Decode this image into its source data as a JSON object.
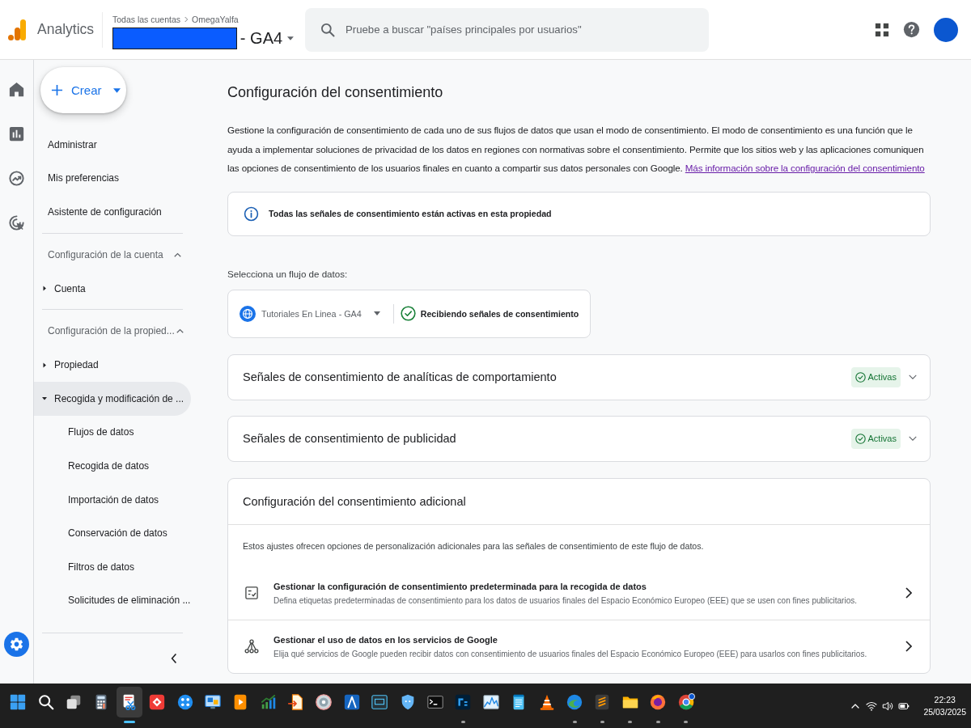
{
  "header": {
    "product": "Analytics",
    "breadcrumb": [
      "Todas las cuentas",
      "OmegaYalfa"
    ],
    "property_suffix": "- GA4",
    "search": {
      "placeholder": "Pruebe a buscar \"países principales por usuarios\""
    }
  },
  "rail": [
    {
      "selected": false
    },
    {
      "selected": false
    },
    {
      "selected": false
    },
    {
      "selected": false
    },
    {
      "selected": true
    }
  ],
  "sidebar": {
    "create_button": {
      "label": "Crear"
    },
    "links": [
      {
        "label": "Administrar",
        "selected": false
      },
      {
        "label": "Mis preferencias",
        "selected": false
      },
      {
        "label": "Asistente de configuración",
        "selected": false
      }
    ],
    "sections": [
      {
        "title": "Configuración de la cuenta",
        "expanded": true,
        "items": [
          {
            "label": "Cuenta",
            "expanded": false,
            "selected": false
          }
        ]
      },
      {
        "title": "Configuración de la propied...",
        "expanded": true,
        "items": [
          {
            "label": "Propiedad",
            "expanded": false,
            "selected": false
          },
          {
            "label": "Recogida y modificación de ...",
            "expanded": true,
            "selected": true,
            "children": [
              {
                "label": "Flujos de datos",
                "selected": false
              },
              {
                "label": "Recogida de datos",
                "selected": false
              },
              {
                "label": "Importación de datos",
                "selected": false
              },
              {
                "label": "Conservación de datos",
                "selected": false
              },
              {
                "label": "Filtros de datos",
                "selected": false
              },
              {
                "label": "Solicitudes de eliminación ...",
                "selected": false
              }
            ]
          }
        ]
      }
    ]
  },
  "page": {
    "title": "Configuración del consentimiento",
    "intro": "Gestione la configuración de consentimiento de cada uno de sus flujos de datos que usan el modo de consentimiento. El modo de consentimiento es una función que le ayuda a implementar soluciones de privacidad de los datos en regiones con normativas sobre el consentimiento. Permite que los sitios web y las aplicaciones comuniquen las opciones de consentimiento de los usuarios finales en cuanto a compartir sus datos personales con Google.",
    "intro_link": "Más información sobre la configuración del consentimiento",
    "notice": "Todas las señales de consentimiento están activas en esta propiedad",
    "stream_label": "Selecciona un flujo de datos:",
    "stream": {
      "name": "Tutoriales En Linea - GA4",
      "status": "Recibiendo señales de consentimiento"
    },
    "signal_panels": [
      {
        "title": "Señales de consentimiento de analíticas de comportamiento",
        "badge": "Activas",
        "expanded": false
      },
      {
        "title": "Señales de consentimiento de publicidad",
        "badge": "Activas",
        "expanded": false
      }
    ],
    "additional": {
      "title": "Configuración del consentimiento adicional",
      "description": "Estos ajustes ofrecen opciones de personalización adicionales para las señales de consentimiento de este flujo de datos.",
      "rows": [
        {
          "kind": "checklist",
          "title": "Gestionar la configuración de consentimiento predeterminada para la recogida de datos",
          "description": "Defina etiquetas predeterminadas de consentimiento para los datos de usuarios finales del Espacio Económico Europeo (EEE) que se usen con fines publicitarios."
        },
        {
          "kind": "branch",
          "title": "Gestionar el uso de datos en los servicios de Google",
          "description": "Elija qué servicios de Google pueden recibir datos con consentimiento de usuarios finales del Espacio Económico Europeo (EEE) para usarlos con fines publicitarios."
        }
      ]
    }
  },
  "taskbar": {
    "apps": [
      {
        "running": false,
        "selected": false
      },
      {
        "running": false,
        "selected": false
      },
      {
        "running": false,
        "selected": false
      },
      {
        "running": false,
        "selected": false
      },
      {
        "running": true,
        "selected": true
      },
      {
        "running": false,
        "selected": false
      },
      {
        "running": false,
        "selected": false
      },
      {
        "running": false,
        "selected": false
      },
      {
        "running": false,
        "selected": false
      },
      {
        "running": false,
        "selected": false
      },
      {
        "running": false,
        "selected": false
      },
      {
        "running": false,
        "selected": false
      },
      {
        "running": false,
        "selected": false
      },
      {
        "running": false,
        "selected": false
      },
      {
        "running": false,
        "selected": false
      },
      {
        "running": false,
        "selected": false
      },
      {
        "running": true,
        "selected": false
      },
      {
        "running": false,
        "selected": false
      },
      {
        "running": false,
        "selected": false
      },
      {
        "running": false,
        "selected": false
      },
      {
        "running": true,
        "selected": false
      },
      {
        "running": true,
        "selected": false
      },
      {
        "running": true,
        "selected": false
      },
      {
        "running": true,
        "selected": false
      },
      {
        "running": true,
        "selected": false
      }
    ],
    "time": "22:23",
    "date": "25/03/2025"
  }
}
